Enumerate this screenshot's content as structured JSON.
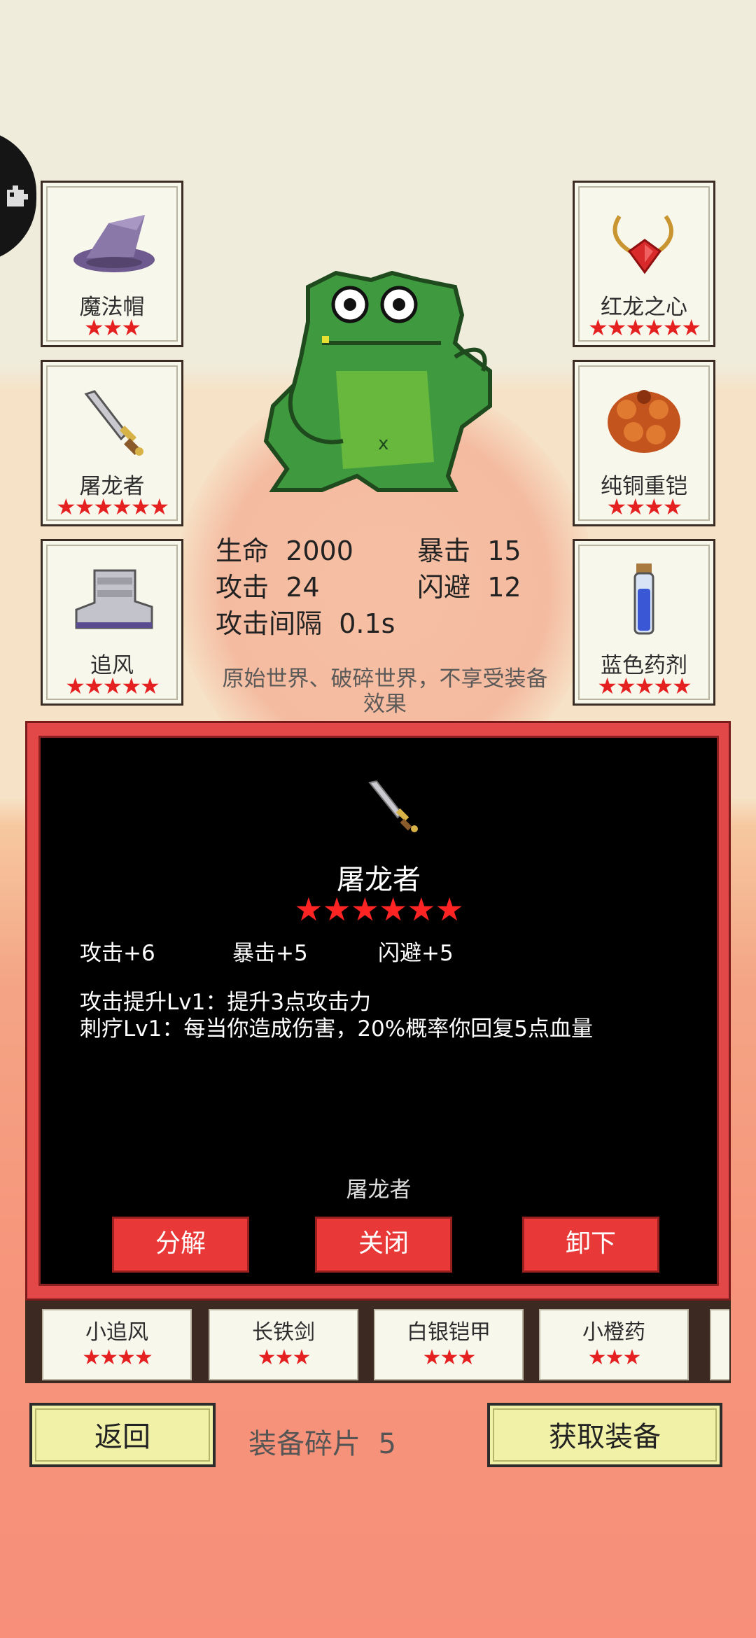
{
  "equipped": {
    "left": [
      {
        "name": "魔法帽",
        "stars": "★★★",
        "icon": "wizard-hat-icon"
      },
      {
        "name": "屠龙者",
        "stars": "★★★★★★",
        "icon": "dagger-icon"
      },
      {
        "name": "追风",
        "stars": "★★★★★",
        "icon": "boots-icon"
      }
    ],
    "right": [
      {
        "name": "红龙之心",
        "stars": "★★★★★★",
        "icon": "amulet-icon"
      },
      {
        "name": "纯铜重铠",
        "stars": "★★★★",
        "icon": "armor-icon"
      },
      {
        "name": "蓝色药剂",
        "stars": "★★★★★",
        "icon": "potion-icon"
      }
    ]
  },
  "stats": {
    "hp_label": "生命",
    "hp": "2000",
    "crit_label": "暴击",
    "crit": "15",
    "atk_label": "攻击",
    "atk": "24",
    "dodge_label": "闪避",
    "dodge": "12",
    "interval_label": "攻击间隔",
    "interval": "0.1s",
    "note": "原始世界、破碎世界，不享受装备效果"
  },
  "dialog": {
    "item_name": "屠龙者",
    "stars": "★★★★★★",
    "attrs": [
      "攻击+6",
      "暴击+5",
      "闪避+5"
    ],
    "skills": [
      "攻击提升Lv1：提升3点攻击力",
      "刺疗Lv1：每当你造成伤害，20%概率你回复5点血量"
    ],
    "owner": "屠龙者",
    "buttons": {
      "decompose": "分解",
      "close": "关闭",
      "unequip": "卸下"
    }
  },
  "inventory": [
    {
      "name": "小追风",
      "stars": "★★★★"
    },
    {
      "name": "长铁剑",
      "stars": "★★★"
    },
    {
      "name": "白银铠甲",
      "stars": "★★★"
    },
    {
      "name": "小橙药",
      "stars": "★★★"
    }
  ],
  "footer": {
    "back": "返回",
    "shards_label": "装备碎片",
    "shards": "5",
    "get": "获取装备"
  },
  "colors": {
    "accent_red": "#e42021",
    "panel_black": "#000000",
    "button_green": "#f1f1a7",
    "frog_green": "#3f9a3f"
  }
}
